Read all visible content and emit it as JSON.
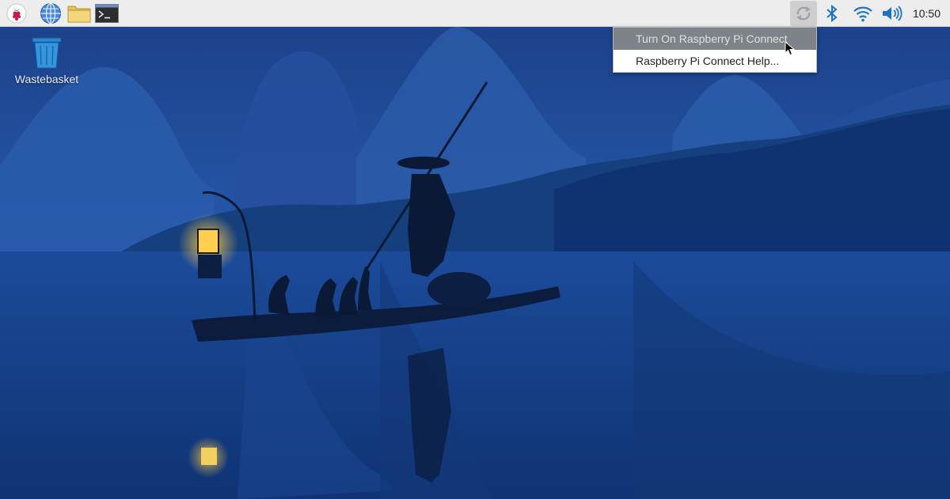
{
  "taskbar": {
    "launchers": [
      {
        "icon": "raspberry-menu-icon"
      },
      {
        "icon": "web-browser-icon"
      },
      {
        "icon": "file-manager-icon"
      },
      {
        "icon": "terminal-icon"
      }
    ],
    "tray": {
      "connect_icon": "raspberry-pi-connect-icon",
      "bluetooth_icon": "bluetooth-icon",
      "wifi_icon": "wifi-icon",
      "volume_icon": "volume-icon",
      "clock": "10:50"
    }
  },
  "desktop": {
    "icons": [
      {
        "label": "Wastebasket",
        "icon": "wastebasket-icon"
      }
    ]
  },
  "connect_menu": {
    "items": [
      {
        "label": "Turn On Raspberry Pi Connect",
        "state": "hovered"
      },
      {
        "label": "Raspberry Pi Connect Help..."
      }
    ]
  },
  "colors": {
    "taskbar_bg": "#ededed",
    "accent_blue": "#1a73c9",
    "menu_hover": "#7d8389",
    "wallpaper_sky": "#1e4f9c",
    "wallpaper_water": "#133d80"
  }
}
